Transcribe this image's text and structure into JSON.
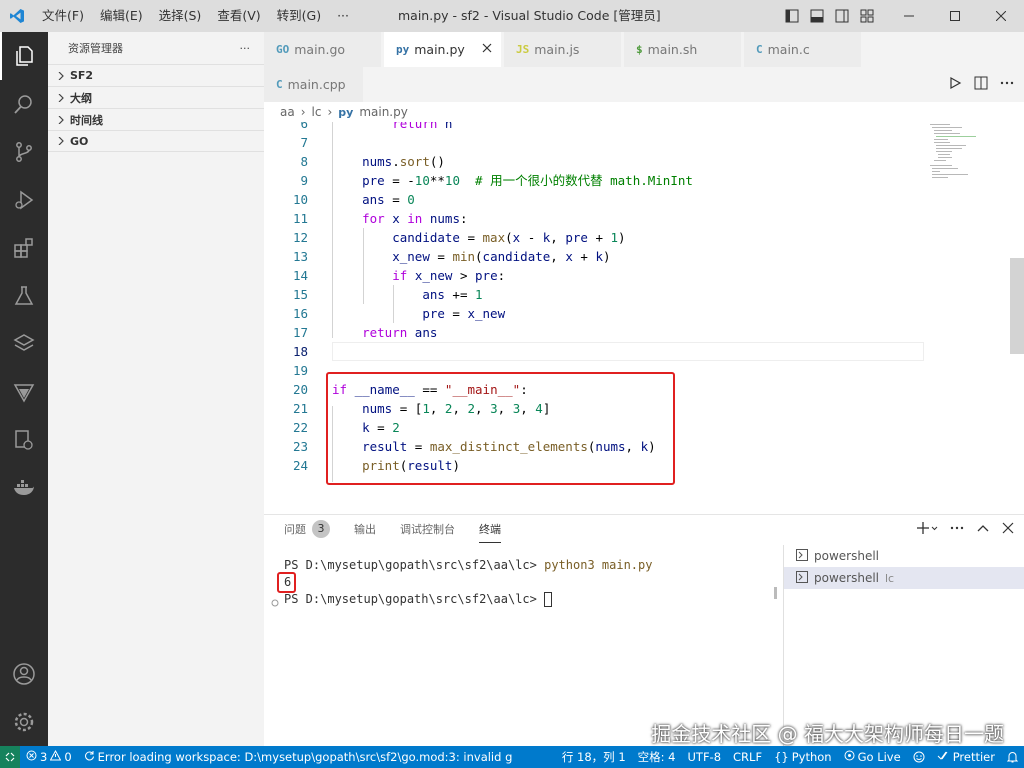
{
  "titlebar": {
    "menu": [
      "文件(F)",
      "编辑(E)",
      "选择(S)",
      "查看(V)",
      "转到(G)",
      "···"
    ],
    "title": "main.py - sf2 - Visual Studio Code [管理员]"
  },
  "sidebar": {
    "header": "资源管理器",
    "more": "···",
    "sections": [
      "SF2",
      "大纲",
      "时间线",
      "GO"
    ]
  },
  "tabs": [
    {
      "label": "main.go",
      "icon": "GO"
    },
    {
      "label": "main.py",
      "icon": "py",
      "active": true
    },
    {
      "label": "main.js",
      "icon": "JS"
    },
    {
      "label": "main.sh",
      "icon": "$"
    },
    {
      "label": "main.c",
      "icon": "C"
    },
    {
      "label": "main.cpp",
      "icon": "C"
    }
  ],
  "breadcrumb": [
    "aa",
    "lc",
    "main.py"
  ],
  "editor": {
    "line_numbers": [
      "6",
      "7",
      "8",
      "9",
      "10",
      "11",
      "12",
      "13",
      "14",
      "15",
      "16",
      "17",
      "18",
      "19",
      "20",
      "21",
      "22",
      "23",
      "24"
    ],
    "comment_line9": "# 用一个很小的数代替 math.MinInt"
  },
  "panel": {
    "tabs": [
      {
        "label": "问题",
        "badge": "3"
      },
      {
        "label": "输出"
      },
      {
        "label": "调试控制台"
      },
      {
        "label": "终端",
        "active": true
      }
    ],
    "terminal": {
      "prompt1": "PS D:\\mysetup\\gopath\\src\\sf2\\aa\\lc> ",
      "command": "python3 main.py",
      "output": "6",
      "prompt2": "PS D:\\mysetup\\gopath\\src\\sf2\\aa\\lc> "
    },
    "terminal_list": [
      {
        "label": "powershell",
        "sub": ""
      },
      {
        "label": "powershell",
        "sub": "lc",
        "selected": true
      }
    ]
  },
  "statusbar": {
    "errors": "3",
    "warnings": "0",
    "message": "Error loading workspace: D:\\mysetup\\gopath\\src\\sf2\\go.mod:3: invalid g",
    "position": "行 18，列 1",
    "spaces": "空格: 4",
    "encoding": "UTF-8",
    "eol": "CRLF",
    "language": "Python",
    "golive": "Go Live",
    "prettier": "Prettier"
  },
  "watermark": "掘金技术社区 @ 福大大架构师每日一题",
  "colors": {
    "accent": "#007acc",
    "highlight_box": "#e02020"
  }
}
